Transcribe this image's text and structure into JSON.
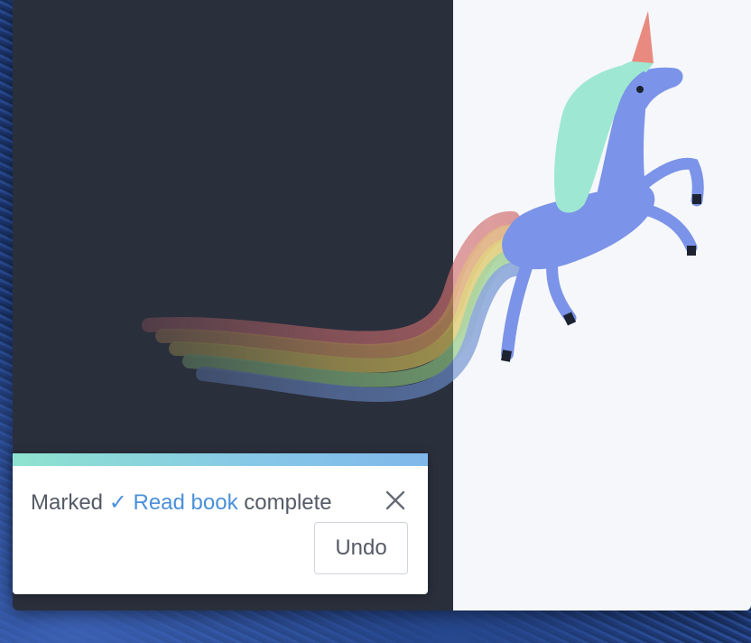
{
  "toast": {
    "prefix": "Marked",
    "check": "✓",
    "task_link": "Read book",
    "suffix": "complete",
    "close_glyph": "✕",
    "undo_label": "Undo"
  },
  "icons": {
    "close": "close-icon",
    "check": "check-icon",
    "illustration": "unicorn-rainbow-illustration"
  },
  "colors": {
    "dark_pane": "#2a2f3c",
    "light_pane": "#f6f7fa",
    "accent_link": "#4a90d9",
    "toast_bar_start": "#8ee3cf",
    "toast_bar_end": "#7fb8ea",
    "unicorn_body": "#7b93e8",
    "unicorn_mane": "#9ee8d3",
    "unicorn_horn": "#e98a80"
  }
}
